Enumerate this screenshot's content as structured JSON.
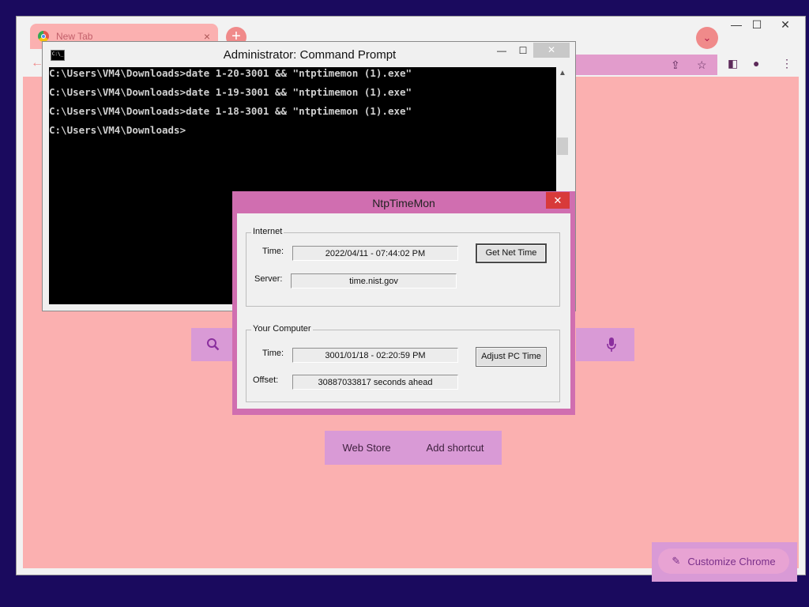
{
  "browser": {
    "tab": {
      "title": "New Tab",
      "close": "×"
    },
    "new_tab": "+",
    "tab_search": "⌄",
    "window_controls": {
      "minimize": "—",
      "maximize": "☐",
      "close": "✕"
    },
    "toolbar": {
      "back": "←",
      "share": "⇪",
      "bookmark": "☆",
      "side_panel": "◧",
      "profile": "●",
      "menu": "⋮"
    },
    "ntp": {
      "search_icon": "search-icon",
      "mic_icon": "mic-icon",
      "shortcuts": [
        "Web Store",
        "Add shortcut"
      ],
      "customize_label": "Customize Chrome",
      "customize_icon": "✎"
    }
  },
  "cmd": {
    "title": "Administrator: Command Prompt",
    "icon_text": "C:\\_",
    "controls": {
      "minimize": "—",
      "maximize": "☐",
      "close": "✕"
    },
    "lines": [
      "C:\\Users\\VM4\\Downloads>date 1-20-3001 && \"ntptimemon (1).exe\"",
      "C:\\Users\\VM4\\Downloads>date 1-19-3001 && \"ntptimemon (1).exe\"",
      "C:\\Users\\VM4\\Downloads>date 1-18-3001 && \"ntptimemon (1).exe\"",
      "C:\\Users\\VM4\\Downloads>"
    ],
    "scroll_up": "▲"
  },
  "ntp_dialog": {
    "title": "NtpTimeMon",
    "close": "✕",
    "internet": {
      "legend": "Internet",
      "time_label": "Time:",
      "time_value": "2022/04/11 - 07:44:02 PM",
      "server_label": "Server:",
      "server_value": "time.nist.gov",
      "button": "Get Net Time"
    },
    "computer": {
      "legend": "Your Computer",
      "time_label": "Time:",
      "time_value": "3001/01/18 - 02:20:59 PM",
      "offset_label": "Offset:",
      "offset_value": "30887033817 seconds ahead",
      "button": "Adjust PC Time"
    }
  }
}
